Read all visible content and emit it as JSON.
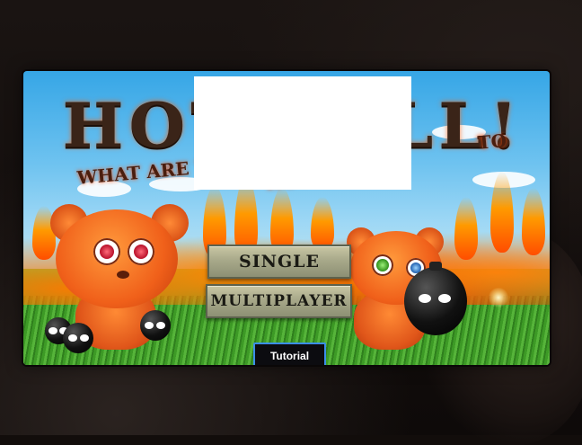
{
  "title": {
    "main": "HOT BALL!",
    "subtitle_left": "WHAT ARE YO",
    "subtitle_right": "TO HOT?"
  },
  "menu": {
    "single_label": "SINGLE",
    "multiplayer_label": "MULTIPLAYER",
    "tutorial_label": "Tutorial"
  },
  "colors": {
    "sky": "#36a6e6",
    "fire": "#ff6a00",
    "grass": "#4fa22c",
    "bear": "#f0601a",
    "button_face": "#a8a98a",
    "tutorial_border": "#3b8ee8"
  }
}
